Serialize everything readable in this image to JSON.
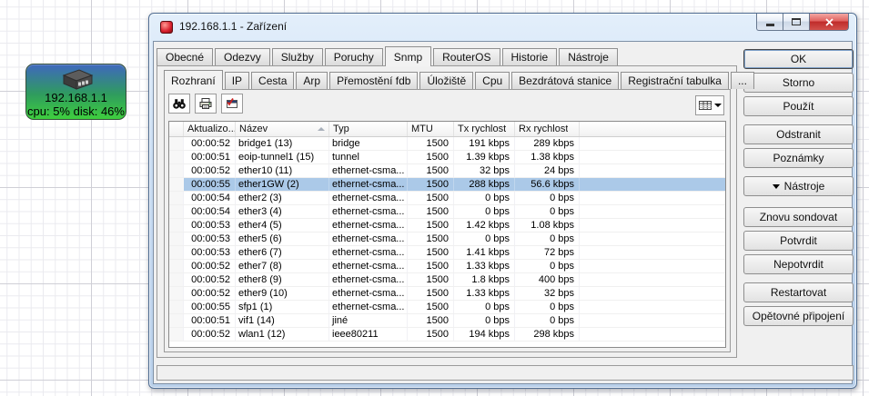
{
  "desktop": {
    "device_node": {
      "ip": "192.168.1.1",
      "stats": "cpu: 5% disk: 46%"
    }
  },
  "window": {
    "title": "192.168.1.1 - Zařízení",
    "controls": [
      "minimize",
      "maximize",
      "close"
    ],
    "tabs": {
      "items": [
        "Obecné",
        "Odezvy",
        "Služby",
        "Poruchy",
        "Snmp",
        "RouterOS",
        "Historie",
        "Nástroje"
      ],
      "active": "Snmp"
    },
    "subtabs": {
      "items": [
        "Rozhraní",
        "IP",
        "Cesta",
        "Arp",
        "Přemostění fdb",
        "Úložiště",
        "Cpu",
        "Bezdrátová stanice",
        "Registrační tabulka",
        "..."
      ],
      "active": "Rozhraní"
    },
    "toolbar": {
      "icons": [
        "binoculars-find-icon",
        "printer-icon",
        "new-window-check-icon"
      ],
      "column_picker_icon": "column-picker-table-icon"
    },
    "table": {
      "columns": [
        "",
        "Aktualizo...",
        "Název",
        "Typ",
        "MTU",
        "Tx rychlost",
        "Rx rychlost"
      ],
      "sort_column": "Název",
      "sort_direction": "asc",
      "rows": [
        {
          "time": "00:00:52",
          "name": "bridge1 (13)",
          "type": "bridge",
          "mtu": "1500",
          "tx": "191 kbps",
          "rx": "289 kbps",
          "selected": false
        },
        {
          "time": "00:00:51",
          "name": "eoip-tunnel1 (15)",
          "type": "tunnel",
          "mtu": "1500",
          "tx": "1.39 kbps",
          "rx": "1.38 kbps",
          "selected": false
        },
        {
          "time": "00:00:52",
          "name": "ether10 (11)",
          "type": "ethernet-csma...",
          "mtu": "1500",
          "tx": "32 bps",
          "rx": "24 bps",
          "selected": false
        },
        {
          "time": "00:00:55",
          "name": "ether1GW (2)",
          "type": "ethernet-csma...",
          "mtu": "1500",
          "tx": "288 kbps",
          "rx": "56.6 kbps",
          "selected": true
        },
        {
          "time": "00:00:54",
          "name": "ether2 (3)",
          "type": "ethernet-csma...",
          "mtu": "1500",
          "tx": "0 bps",
          "rx": "0 bps",
          "selected": false
        },
        {
          "time": "00:00:54",
          "name": "ether3 (4)",
          "type": "ethernet-csma...",
          "mtu": "1500",
          "tx": "0 bps",
          "rx": "0 bps",
          "selected": false
        },
        {
          "time": "00:00:53",
          "name": "ether4 (5)",
          "type": "ethernet-csma...",
          "mtu": "1500",
          "tx": "1.42 kbps",
          "rx": "1.08 kbps",
          "selected": false
        },
        {
          "time": "00:00:53",
          "name": "ether5 (6)",
          "type": "ethernet-csma...",
          "mtu": "1500",
          "tx": "0 bps",
          "rx": "0 bps",
          "selected": false
        },
        {
          "time": "00:00:53",
          "name": "ether6 (7)",
          "type": "ethernet-csma...",
          "mtu": "1500",
          "tx": "1.41 kbps",
          "rx": "72 bps",
          "selected": false
        },
        {
          "time": "00:00:52",
          "name": "ether7 (8)",
          "type": "ethernet-csma...",
          "mtu": "1500",
          "tx": "1.33 kbps",
          "rx": "0 bps",
          "selected": false
        },
        {
          "time": "00:00:52",
          "name": "ether8 (9)",
          "type": "ethernet-csma...",
          "mtu": "1500",
          "tx": "1.8 kbps",
          "rx": "400 bps",
          "selected": false
        },
        {
          "time": "00:00:52",
          "name": "ether9 (10)",
          "type": "ethernet-csma...",
          "mtu": "1500",
          "tx": "1.33 kbps",
          "rx": "32 bps",
          "selected": false
        },
        {
          "time": "00:00:55",
          "name": "sfp1 (1)",
          "type": "ethernet-csma...",
          "mtu": "1500",
          "tx": "0 bps",
          "rx": "0 bps",
          "selected": false
        },
        {
          "time": "00:00:51",
          "name": "vif1 (14)",
          "type": "jiné",
          "mtu": "1500",
          "tx": "0 bps",
          "rx": "0 bps",
          "selected": false
        },
        {
          "time": "00:00:52",
          "name": "wlan1 (12)",
          "type": "ieee80211",
          "mtu": "1500",
          "tx": "194 kbps",
          "rx": "298 kbps",
          "selected": false
        }
      ]
    },
    "button_groups": [
      {
        "buttons": [
          {
            "label": "OK",
            "default": true
          },
          {
            "label": "Storno"
          },
          {
            "label": "Použít"
          }
        ]
      },
      {
        "buttons": [
          {
            "label": "Odstranit"
          },
          {
            "label": "Poznámky"
          }
        ]
      },
      {
        "buttons": [
          {
            "label": "Nástroje",
            "dropdown": true
          }
        ]
      },
      {
        "buttons": [
          {
            "label": "Znovu sondovat"
          },
          {
            "label": "Potvrdit"
          },
          {
            "label": "Nepotvrdit"
          }
        ]
      },
      {
        "buttons": [
          {
            "label": "Restartovat"
          },
          {
            "label": "Opětovné připojení"
          }
        ]
      }
    ]
  },
  "colors": {
    "selection_blue": "#abc9e8",
    "node_gradient_top": "#3f68bd",
    "node_gradient_bottom": "#3ecf3e",
    "close_button_red": "#bf2b2a"
  }
}
